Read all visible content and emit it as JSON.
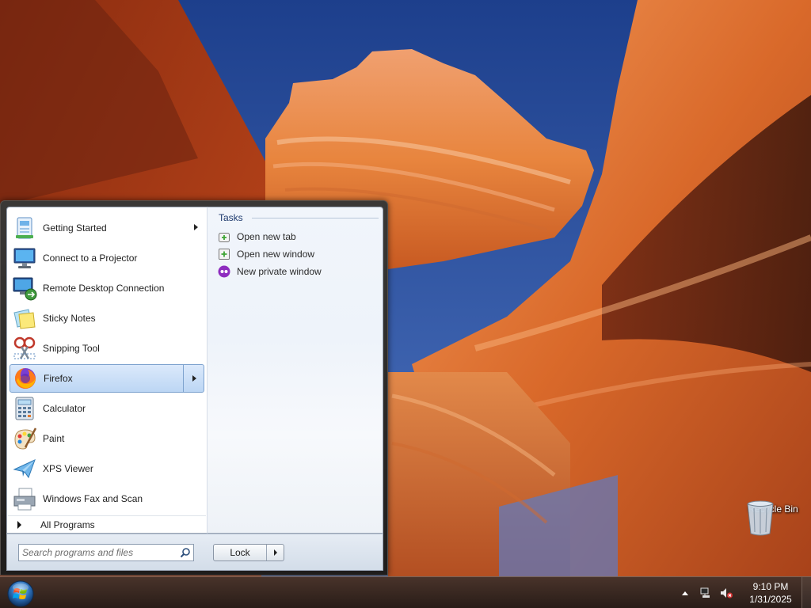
{
  "desktop": {
    "icons": [
      {
        "label": "Recycle Bin",
        "icon": "recycle-bin-icon"
      }
    ]
  },
  "start_menu": {
    "programs": [
      {
        "label": "Getting Started",
        "icon": "getting-started-icon",
        "has_submenu": true,
        "selected": false
      },
      {
        "label": "Connect to a Projector",
        "icon": "projector-icon",
        "has_submenu": false,
        "selected": false
      },
      {
        "label": "Remote Desktop Connection",
        "icon": "remote-desktop-icon",
        "has_submenu": false,
        "selected": false
      },
      {
        "label": "Sticky Notes",
        "icon": "sticky-notes-icon",
        "has_submenu": false,
        "selected": false
      },
      {
        "label": "Snipping Tool",
        "icon": "snipping-tool-icon",
        "has_submenu": false,
        "selected": false
      },
      {
        "label": "Firefox",
        "icon": "firefox-icon",
        "has_submenu": true,
        "selected": true
      },
      {
        "label": "Calculator",
        "icon": "calculator-icon",
        "has_submenu": false,
        "selected": false
      },
      {
        "label": "Paint",
        "icon": "paint-icon",
        "has_submenu": false,
        "selected": false
      },
      {
        "label": "XPS Viewer",
        "icon": "xps-viewer-icon",
        "has_submenu": false,
        "selected": false
      },
      {
        "label": "Windows Fax and Scan",
        "icon": "fax-scan-icon",
        "has_submenu": false,
        "selected": false
      }
    ],
    "all_programs_label": "All Programs",
    "tasks": {
      "header": "Tasks",
      "items": [
        {
          "label": "Open new tab",
          "icon": "new-tab-icon"
        },
        {
          "label": "Open new window",
          "icon": "new-window-icon"
        },
        {
          "label": "New private window",
          "icon": "private-window-icon"
        }
      ]
    },
    "search": {
      "placeholder": "Search programs and files",
      "value": ""
    },
    "lock_label": "Lock"
  },
  "taskbar": {
    "clock": {
      "time": "9:10 PM",
      "date": "1/31/2025"
    },
    "tray_icons": [
      "show-hidden-icons",
      "network-icon",
      "volume-muted-icon"
    ]
  },
  "colors": {
    "selection_fill": "#c4dcf6",
    "selection_border": "#7da2ce",
    "tasks_header": "#1e3a6e",
    "taskbar": "#3b2b24"
  }
}
